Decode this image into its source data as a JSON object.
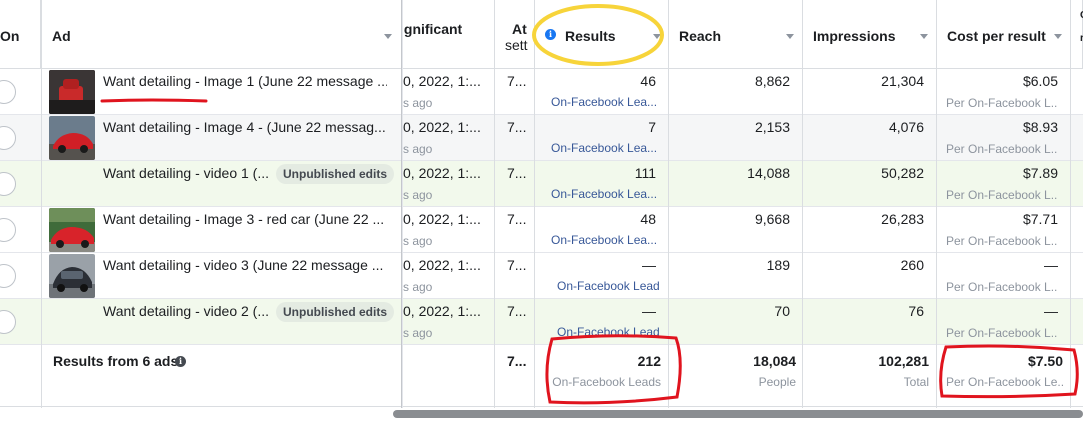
{
  "header": {
    "on": "On",
    "ad": "Ad",
    "significant": "ignificant",
    "attribution": [
      "At",
      "sett"
    ],
    "results": "Results",
    "reach": "Reach",
    "impressions": "Impressions",
    "cost_per_result": "Cost per result"
  },
  "rows": [
    {
      "name": "Want detailing - Image 1 (June 22 message ...",
      "badge": "",
      "date": "0, 2022, 1:...",
      "ago": "s ago",
      "attr": "7...",
      "results": "46",
      "results_type": "On-Facebook Lea...",
      "reach": "8,862",
      "impressions": "21,304",
      "cost": "$6.05",
      "cost_type": "Per On-Facebook L..."
    },
    {
      "name": "Want detailing - Image 4 - (June 22 messag...",
      "badge": "",
      "date": "0, 2022, 1:...",
      "ago": "s ago",
      "attr": "7...",
      "results": "7",
      "results_type": "On-Facebook Lea...",
      "reach": "2,153",
      "impressions": "4,076",
      "cost": "$8.93",
      "cost_type": "Per On-Facebook L..."
    },
    {
      "name": "Want detailing - video 1 (...",
      "badge": "Unpublished edits",
      "date": "0, 2022, 1:...",
      "ago": "s ago",
      "attr": "7...",
      "results": "111",
      "results_type": "On-Facebook Lea...",
      "reach": "14,088",
      "impressions": "50,282",
      "cost": "$7.89",
      "cost_type": "Per On-Facebook L..."
    },
    {
      "name": "Want detailing - Image 3 - red car (June 22 ...",
      "badge": "",
      "date": "0, 2022, 1:...",
      "ago": "s ago",
      "attr": "7...",
      "results": "48",
      "results_type": "On-Facebook Lea...",
      "reach": "9,668",
      "impressions": "26,283",
      "cost": "$7.71",
      "cost_type": "Per On-Facebook L..."
    },
    {
      "name": "Want detailing - video 3 (June 22 message ...",
      "badge": "",
      "date": "0, 2022, 1:...",
      "ago": "s ago",
      "attr": "7...",
      "results": "—",
      "results_type": "On-Facebook Lead",
      "reach": "189",
      "impressions": "260",
      "cost": "—",
      "cost_type": "Per On-Facebook L..."
    },
    {
      "name": "Want detailing - video 2 (...",
      "badge": "Unpublished edits",
      "date": "0, 2022, 1:...",
      "ago": "s ago",
      "attr": "7...",
      "results": "—",
      "results_type": "On-Facebook Lead",
      "reach": "70",
      "impressions": "76",
      "cost": "—",
      "cost_type": "Per On-Facebook L..."
    }
  ],
  "totals": {
    "label": "Results from 6 ads",
    "attr": "7...",
    "results": "212",
    "results_type": "On-Facebook Leads",
    "reach": "18,084",
    "reach_type": "People",
    "impressions": "102,281",
    "impressions_type": "Total",
    "cost": "$7.50",
    "cost_type": "Per On-Facebook Le..."
  },
  "colors": {
    "highlight_yellow": "#f7d43a",
    "annotation_red": "#e0141e",
    "edited_row": "#f2f9ec",
    "link_blue": "#385898"
  }
}
